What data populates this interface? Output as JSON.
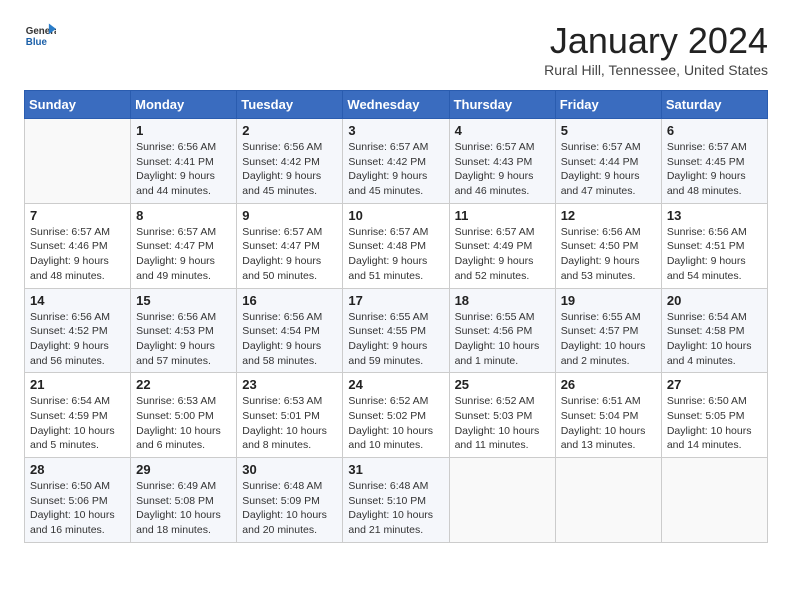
{
  "header": {
    "logo_line1": "General",
    "logo_line2": "Blue",
    "month": "January 2024",
    "location": "Rural Hill, Tennessee, United States"
  },
  "weekdays": [
    "Sunday",
    "Monday",
    "Tuesday",
    "Wednesday",
    "Thursday",
    "Friday",
    "Saturday"
  ],
  "weeks": [
    [
      {
        "day": "",
        "info": ""
      },
      {
        "day": "1",
        "info": "Sunrise: 6:56 AM\nSunset: 4:41 PM\nDaylight: 9 hours\nand 44 minutes."
      },
      {
        "day": "2",
        "info": "Sunrise: 6:56 AM\nSunset: 4:42 PM\nDaylight: 9 hours\nand 45 minutes."
      },
      {
        "day": "3",
        "info": "Sunrise: 6:57 AM\nSunset: 4:42 PM\nDaylight: 9 hours\nand 45 minutes."
      },
      {
        "day": "4",
        "info": "Sunrise: 6:57 AM\nSunset: 4:43 PM\nDaylight: 9 hours\nand 46 minutes."
      },
      {
        "day": "5",
        "info": "Sunrise: 6:57 AM\nSunset: 4:44 PM\nDaylight: 9 hours\nand 47 minutes."
      },
      {
        "day": "6",
        "info": "Sunrise: 6:57 AM\nSunset: 4:45 PM\nDaylight: 9 hours\nand 48 minutes."
      }
    ],
    [
      {
        "day": "7",
        "info": "Sunrise: 6:57 AM\nSunset: 4:46 PM\nDaylight: 9 hours\nand 48 minutes."
      },
      {
        "day": "8",
        "info": "Sunrise: 6:57 AM\nSunset: 4:47 PM\nDaylight: 9 hours\nand 49 minutes."
      },
      {
        "day": "9",
        "info": "Sunrise: 6:57 AM\nSunset: 4:47 PM\nDaylight: 9 hours\nand 50 minutes."
      },
      {
        "day": "10",
        "info": "Sunrise: 6:57 AM\nSunset: 4:48 PM\nDaylight: 9 hours\nand 51 minutes."
      },
      {
        "day": "11",
        "info": "Sunrise: 6:57 AM\nSunset: 4:49 PM\nDaylight: 9 hours\nand 52 minutes."
      },
      {
        "day": "12",
        "info": "Sunrise: 6:56 AM\nSunset: 4:50 PM\nDaylight: 9 hours\nand 53 minutes."
      },
      {
        "day": "13",
        "info": "Sunrise: 6:56 AM\nSunset: 4:51 PM\nDaylight: 9 hours\nand 54 minutes."
      }
    ],
    [
      {
        "day": "14",
        "info": "Sunrise: 6:56 AM\nSunset: 4:52 PM\nDaylight: 9 hours\nand 56 minutes."
      },
      {
        "day": "15",
        "info": "Sunrise: 6:56 AM\nSunset: 4:53 PM\nDaylight: 9 hours\nand 57 minutes."
      },
      {
        "day": "16",
        "info": "Sunrise: 6:56 AM\nSunset: 4:54 PM\nDaylight: 9 hours\nand 58 minutes."
      },
      {
        "day": "17",
        "info": "Sunrise: 6:55 AM\nSunset: 4:55 PM\nDaylight: 9 hours\nand 59 minutes."
      },
      {
        "day": "18",
        "info": "Sunrise: 6:55 AM\nSunset: 4:56 PM\nDaylight: 10 hours\nand 1 minute."
      },
      {
        "day": "19",
        "info": "Sunrise: 6:55 AM\nSunset: 4:57 PM\nDaylight: 10 hours\nand 2 minutes."
      },
      {
        "day": "20",
        "info": "Sunrise: 6:54 AM\nSunset: 4:58 PM\nDaylight: 10 hours\nand 4 minutes."
      }
    ],
    [
      {
        "day": "21",
        "info": "Sunrise: 6:54 AM\nSunset: 4:59 PM\nDaylight: 10 hours\nand 5 minutes."
      },
      {
        "day": "22",
        "info": "Sunrise: 6:53 AM\nSunset: 5:00 PM\nDaylight: 10 hours\nand 6 minutes."
      },
      {
        "day": "23",
        "info": "Sunrise: 6:53 AM\nSunset: 5:01 PM\nDaylight: 10 hours\nand 8 minutes."
      },
      {
        "day": "24",
        "info": "Sunrise: 6:52 AM\nSunset: 5:02 PM\nDaylight: 10 hours\nand 10 minutes."
      },
      {
        "day": "25",
        "info": "Sunrise: 6:52 AM\nSunset: 5:03 PM\nDaylight: 10 hours\nand 11 minutes."
      },
      {
        "day": "26",
        "info": "Sunrise: 6:51 AM\nSunset: 5:04 PM\nDaylight: 10 hours\nand 13 minutes."
      },
      {
        "day": "27",
        "info": "Sunrise: 6:50 AM\nSunset: 5:05 PM\nDaylight: 10 hours\nand 14 minutes."
      }
    ],
    [
      {
        "day": "28",
        "info": "Sunrise: 6:50 AM\nSunset: 5:06 PM\nDaylight: 10 hours\nand 16 minutes."
      },
      {
        "day": "29",
        "info": "Sunrise: 6:49 AM\nSunset: 5:08 PM\nDaylight: 10 hours\nand 18 minutes."
      },
      {
        "day": "30",
        "info": "Sunrise: 6:48 AM\nSunset: 5:09 PM\nDaylight: 10 hours\nand 20 minutes."
      },
      {
        "day": "31",
        "info": "Sunrise: 6:48 AM\nSunset: 5:10 PM\nDaylight: 10 hours\nand 21 minutes."
      },
      {
        "day": "",
        "info": ""
      },
      {
        "day": "",
        "info": ""
      },
      {
        "day": "",
        "info": ""
      }
    ]
  ]
}
